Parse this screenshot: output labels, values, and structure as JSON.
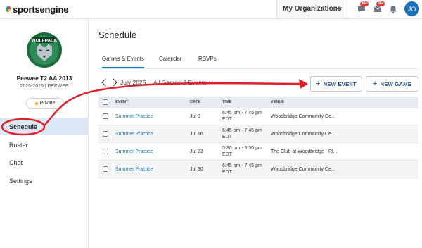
{
  "brand": {
    "name": "sportsengine"
  },
  "header": {
    "org_selector": "My Organizations",
    "badges": {
      "messages": "99+",
      "inbox": "99+"
    },
    "avatar_initials": "JO"
  },
  "sidebar": {
    "team_name": "Peewee T2 AA 2013",
    "season": "2025-2026 | PEEWEE",
    "privacy": "Private",
    "nav": [
      {
        "label": "Schedule",
        "active": true
      },
      {
        "label": "Roster",
        "active": false
      },
      {
        "label": "Chat",
        "active": false
      },
      {
        "label": "Settings",
        "active": false
      }
    ]
  },
  "main": {
    "title": "Schedule",
    "tabs": [
      {
        "label": "Games & Events",
        "active": true
      },
      {
        "label": "Calendar",
        "active": false
      },
      {
        "label": "RSVPs",
        "active": false
      }
    ],
    "month": "July 2025",
    "filter": "All Games & Events",
    "buttons": {
      "new_event": "NEW EVENT",
      "new_game": "NEW GAME"
    },
    "table": {
      "columns": [
        "EVENT",
        "DATE",
        "TIME",
        "VENUE"
      ],
      "rows": [
        {
          "event": "Summer Practice",
          "date": "Jul 9",
          "time_1": "6:45 pm - 7:45 pm",
          "time_2": "EDT",
          "venue": "Woodbridge Community Ce..."
        },
        {
          "event": "Summer Practice",
          "date": "Jul 16",
          "time_1": "6:45 pm - 7:45 pm",
          "time_2": "EDT",
          "venue": "Woodbridge Community Ce..."
        },
        {
          "event": "Summer Practice",
          "date": "Jul 23",
          "time_1": "5:30 pm - 6:30 pm",
          "time_2": "EDT",
          "venue": "The Club at Woodbridge - Rl..."
        },
        {
          "event": "Summer Practice",
          "date": "Jul 30",
          "time_1": "6:45 pm - 7:45 pm",
          "time_2": "EDT",
          "venue": "Woodbridge Community Ce..."
        }
      ]
    }
  },
  "colors": {
    "accent": "#1b6fb5",
    "annotation": "#e0202a",
    "active_nav_bg": "#dbe8f5"
  }
}
